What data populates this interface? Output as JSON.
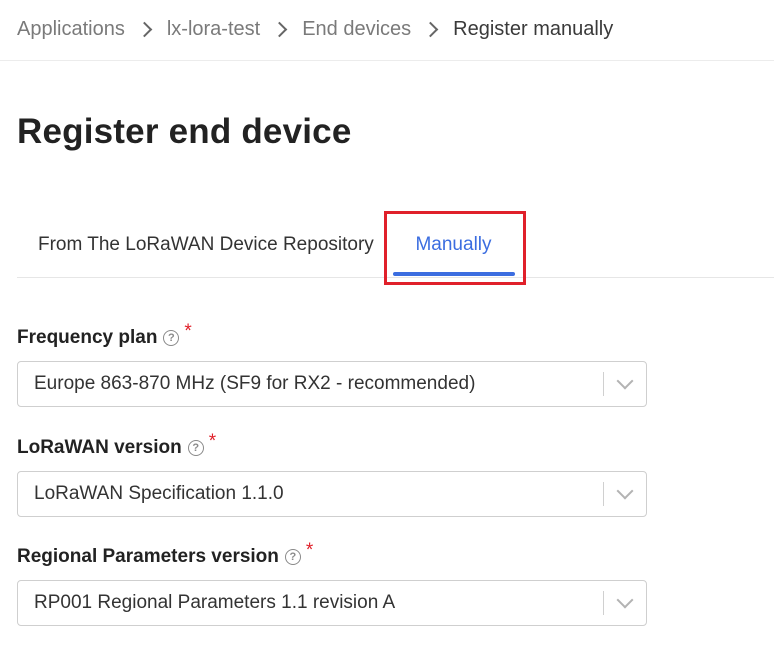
{
  "breadcrumb": {
    "items": [
      "Applications",
      "lx-lora-test",
      "End devices"
    ],
    "current": "Register manually"
  },
  "page_title": "Register end device",
  "tabs": {
    "repository": "From The LoRaWAN Device Repository",
    "manually": "Manually",
    "active": "manually"
  },
  "form": {
    "frequency_plan": {
      "label": "Frequency plan",
      "required": "*",
      "help": "?",
      "value": "Europe 863-870 MHz (SF9 for RX2 - recommended)"
    },
    "lorawan_version": {
      "label": "LoRaWAN version",
      "required": "*",
      "help": "?",
      "value": "LoRaWAN Specification 1.1.0"
    },
    "regional_parameters": {
      "label": "Regional Parameters version",
      "required": "*",
      "help": "?",
      "value": "RP001 Regional Parameters 1.1 revision A"
    }
  },
  "colors": {
    "accent": "#3b6de0",
    "highlight": "#e0202a",
    "required": "#e0202a"
  },
  "icons": {
    "breadcrumb_separator": "chevron-right-icon",
    "help": "help-circle-icon",
    "select_arrow": "chevron-down-icon"
  }
}
